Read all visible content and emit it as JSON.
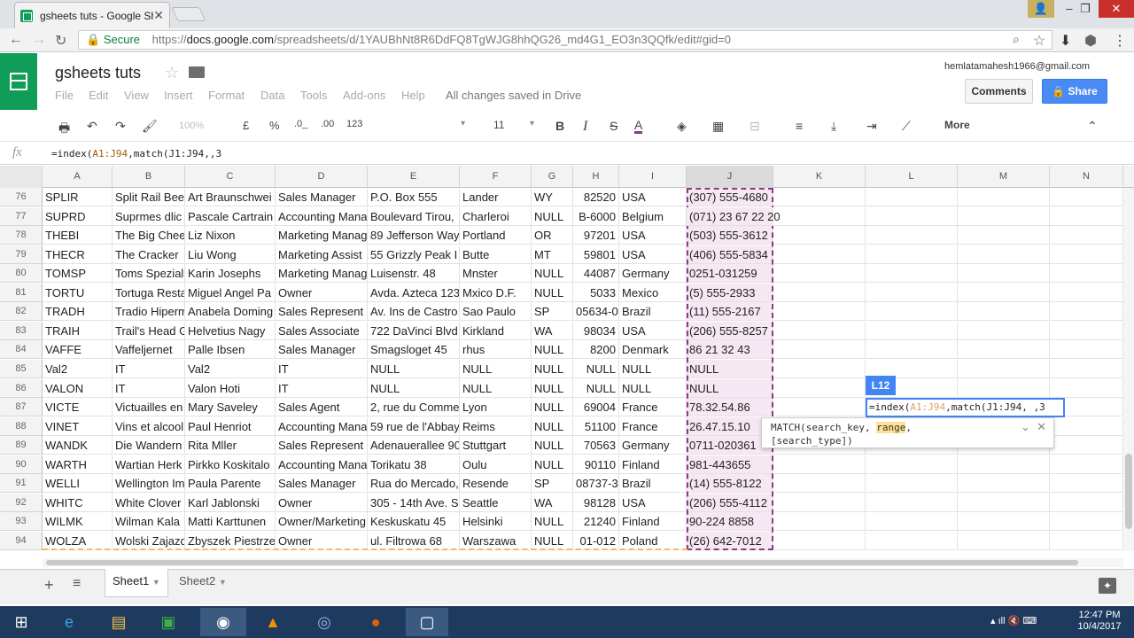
{
  "browser": {
    "tab_title": "gsheets tuts - Google Sh",
    "url_secure": "Secure",
    "url_scheme": "https://",
    "url_host": "docs.google.com",
    "url_path": "/spreadsheets/d/1YAUBhNt8R6DdFQ8TgWJG8hhQG26_md4G1_EO3n3QQfk/edit#gid=0"
  },
  "doc": {
    "title": "gsheets tuts",
    "menu": [
      "File",
      "Edit",
      "View",
      "Insert",
      "Format",
      "Data",
      "Tools",
      "Add-ons",
      "Help"
    ],
    "save_status": "All changes saved in Drive",
    "account": "hemlatamahesh1966@gmail.com",
    "comments_label": "Comments",
    "share_label": "Share"
  },
  "toolbar": {
    "zoom": "100%",
    "currency": "£",
    "percent": "%",
    "dec_less": ".0_",
    "dec_more": ".00",
    "format": "123",
    "font_size": "11",
    "more_label": "More"
  },
  "formula_bar": {
    "fx": "fx",
    "text_pre": "=index(",
    "text_range": "A1:J94",
    "text_post": ",match(J1:J94,,3"
  },
  "columns": [
    "A",
    "B",
    "C",
    "D",
    "E",
    "F",
    "G",
    "H",
    "I",
    "J",
    "K",
    "L",
    "M",
    "N"
  ],
  "rows": [
    {
      "n": "76",
      "c": [
        "SPLIR",
        "Split Rail Bee",
        "Art Braunschwei",
        "Sales Manager",
        "P.O. Box 555",
        "Lander",
        "WY",
        "82520",
        "USA",
        "(307) 555-4680"
      ]
    },
    {
      "n": "77",
      "c": [
        "SUPRD",
        "Suprmes dlic",
        "Pascale Cartrain",
        "Accounting Mana",
        "Boulevard Tirou,",
        "Charleroi",
        "NULL",
        "B-6000",
        "Belgium",
        "(071) 23 67 22 20"
      ]
    },
    {
      "n": "78",
      "c": [
        "THEBI",
        "The Big Chee",
        "Liz Nixon",
        "Marketing Manag",
        "89 Jefferson Way",
        "Portland",
        "OR",
        "97201",
        "USA",
        "(503) 555-3612"
      ]
    },
    {
      "n": "79",
      "c": [
        "THECR",
        "The Cracker",
        "Liu Wong",
        "Marketing Assist",
        "55 Grizzly Peak I",
        "Butte",
        "MT",
        "59801",
        "USA",
        "(406) 555-5834"
      ]
    },
    {
      "n": "80",
      "c": [
        "TOMSP",
        "Toms Spezial",
        "Karin Josephs",
        "Marketing Manag",
        "Luisenstr. 48",
        "Mnster",
        "NULL",
        "44087",
        "Germany",
        "0251-031259"
      ]
    },
    {
      "n": "81",
      "c": [
        "TORTU",
        "Tortuga Resta",
        "Miguel Angel Pa",
        "Owner",
        "Avda. Azteca 123",
        "Mxico D.F.",
        "NULL",
        "5033",
        "Mexico",
        "(5) 555-2933"
      ]
    },
    {
      "n": "82",
      "c": [
        "TRADH",
        "Tradio Hiperm",
        "Anabela Doming",
        "Sales Represent",
        "Av. Ins de Castro",
        "Sao Paulo",
        "SP",
        "05634-0",
        "Brazil",
        "(11) 555-2167"
      ]
    },
    {
      "n": "83",
      "c": [
        "TRAIH",
        "Trail's Head G",
        "Helvetius Nagy",
        "Sales Associate",
        "722 DaVinci Blvd",
        "Kirkland",
        "WA",
        "98034",
        "USA",
        "(206) 555-8257"
      ]
    },
    {
      "n": "84",
      "c": [
        "VAFFE",
        "Vaffeljernet",
        "Palle Ibsen",
        "Sales Manager",
        "Smagsloget 45",
        "rhus",
        "NULL",
        "8200",
        "Denmark",
        "86 21 32 43"
      ]
    },
    {
      "n": "85",
      "c": [
        "Val2",
        "IT",
        "Val2",
        "IT",
        "NULL",
        "NULL",
        "NULL",
        "NULL",
        "NULL",
        "NULL"
      ]
    },
    {
      "n": "86",
      "c": [
        "VALON",
        "IT",
        "Valon Hoti",
        "IT",
        "NULL",
        "NULL",
        "NULL",
        "NULL",
        "NULL",
        "NULL"
      ]
    },
    {
      "n": "87",
      "c": [
        "VICTE",
        "Victuailles en",
        "Mary Saveley",
        "Sales Agent",
        "2, rue du Comme",
        "Lyon",
        "NULL",
        "69004",
        "France",
        "78.32.54.86"
      ]
    },
    {
      "n": "88",
      "c": [
        "VINET",
        "Vins et alcool",
        "Paul Henriot",
        "Accounting Mana",
        "59 rue de l'Abbay",
        "Reims",
        "NULL",
        "51100",
        "France",
        "26.47.15.10"
      ]
    },
    {
      "n": "89",
      "c": [
        "WANDK",
        "Die Wandern",
        "Rita Mller",
        "Sales Represent",
        "Adenauerallee 90",
        "Stuttgart",
        "NULL",
        "70563",
        "Germany",
        "0711-020361"
      ]
    },
    {
      "n": "90",
      "c": [
        "WARTH",
        "Wartian Herk",
        "Pirkko Koskitalo",
        "Accounting Mana",
        "Torikatu 38",
        "Oulu",
        "NULL",
        "90110",
        "Finland",
        "981-443655"
      ]
    },
    {
      "n": "91",
      "c": [
        "WELLI",
        "Wellington Im",
        "Paula Parente",
        "Sales Manager",
        "Rua do Mercado,",
        "Resende",
        "SP",
        "08737-3",
        "Brazil",
        "(14) 555-8122"
      ]
    },
    {
      "n": "92",
      "c": [
        "WHITC",
        "White Clover",
        "Karl Jablonski",
        "Owner",
        "305 - 14th Ave. S",
        "Seattle",
        "WA",
        "98128",
        "USA",
        "(206) 555-4112"
      ]
    },
    {
      "n": "93",
      "c": [
        "WILMK",
        "Wilman Kala",
        "Matti Karttunen",
        "Owner/Marketing",
        "Keskuskatu 45",
        "Helsinki",
        "NULL",
        "21240",
        "Finland",
        "90-224 8858"
      ]
    },
    {
      "n": "94",
      "c": [
        "WOLZA",
        "Wolski Zajazd",
        "Zbyszek Piestrze",
        "Owner",
        "ul. Filtrowa 68",
        "Warszawa",
        "NULL",
        "01-012",
        "Poland",
        "(26) 642-7012"
      ]
    }
  ],
  "editor": {
    "cell_label": "L12",
    "pre": "=index(",
    "range": "A1:J94",
    "post": ",match(J1:J94, ,3",
    "hint_fn": "MATCH(search_key, ",
    "hint_hl": "range",
    "hint_rest": ",",
    "hint_line2": "[search_type])"
  },
  "sheets": [
    "Sheet1",
    "Sheet2"
  ],
  "clock": {
    "time": "12:47 PM",
    "date": "10/4/2017"
  }
}
